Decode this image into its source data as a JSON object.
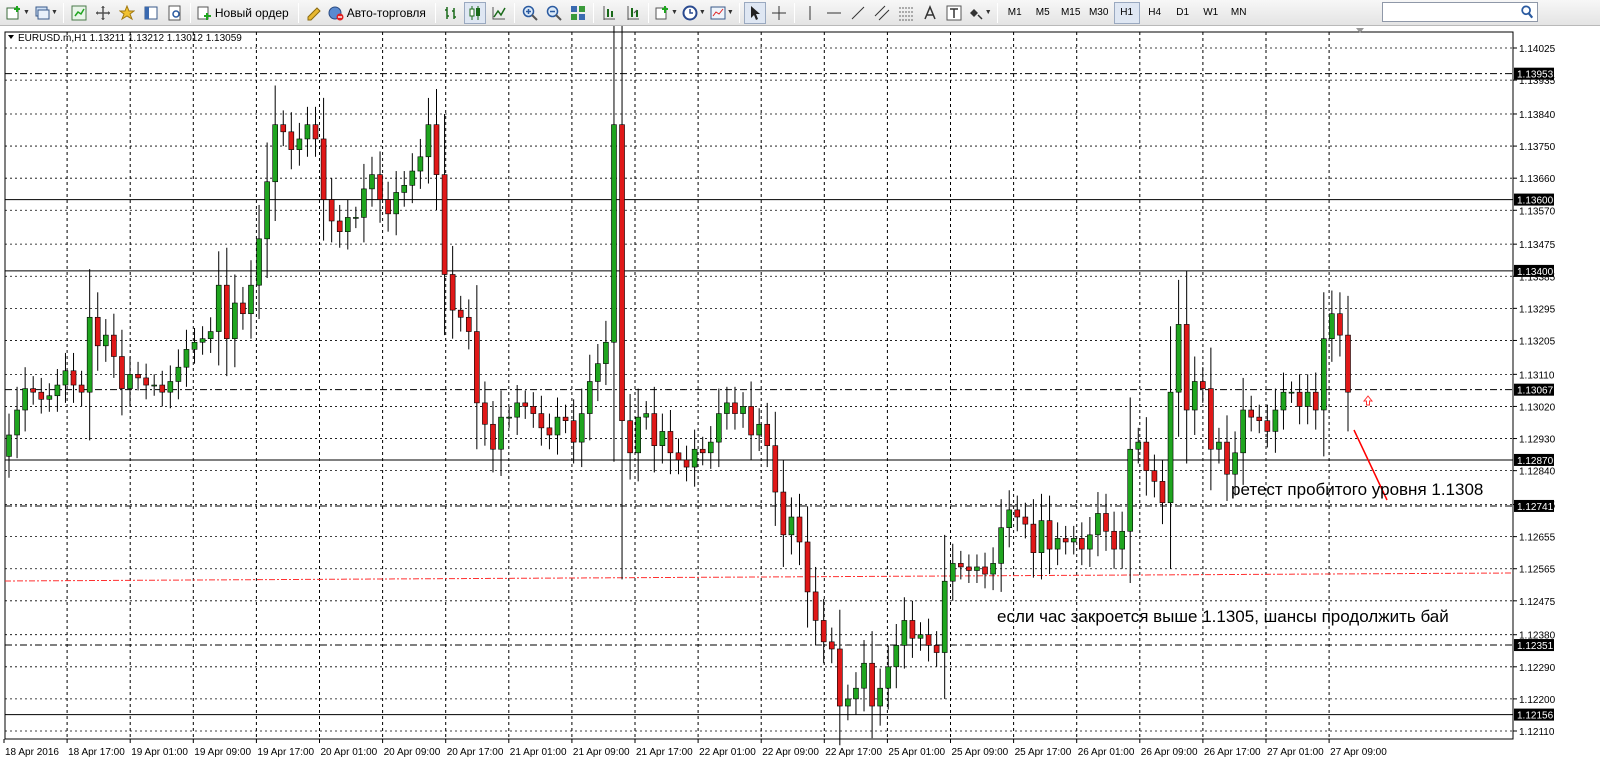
{
  "toolbar": {
    "new_order_label": "Новый ордер",
    "auto_trading_label": "Авто-торговля",
    "timeframes": [
      "M1",
      "M5",
      "M15",
      "M30",
      "H1",
      "H4",
      "D1",
      "W1",
      "MN"
    ],
    "active_timeframe": "H1",
    "search_value": ""
  },
  "chart": {
    "header": "EURUSD.m,H1  1.13211 1.13212 1.13012 1.13059",
    "bull_color": "#1fa51f",
    "bear_color": "#e01818",
    "price_axis_ticks": [
      "1.14025",
      "1.13935",
      "1.13840",
      "1.13750",
      "1.13660",
      "1.13570",
      "1.13475",
      "1.13385",
      "1.13295",
      "1.13205",
      "1.13110",
      "1.13020",
      "1.12930",
      "1.12840",
      "1.12745",
      "1.12655",
      "1.12565",
      "1.12475",
      "1.12380",
      "1.12290",
      "1.12200",
      "1.12110"
    ],
    "level_lines": [
      {
        "price": 1.13953,
        "label": "1.13953",
        "style": "dashdot"
      },
      {
        "price": 1.136,
        "label": "1.13600",
        "style": "solid"
      },
      {
        "price": 1.134,
        "label": "1.13400",
        "style": "solid"
      },
      {
        "price": 1.13067,
        "label": "1.13067",
        "style": "dashdot"
      },
      {
        "price": 1.1287,
        "label": "1.12870",
        "style": "solid"
      },
      {
        "price": 1.12741,
        "label": "1.12741",
        "style": "dashdot"
      },
      {
        "price": 1.12351,
        "label": "1.12351",
        "style": "dashdot"
      },
      {
        "price": 1.12156,
        "label": "1.12156",
        "style": "solid"
      }
    ],
    "time_axis_labels": [
      "18 Apr 2016",
      "18 Apr 17:00",
      "19 Apr 01:00",
      "19 Apr 09:00",
      "19 Apr 17:00",
      "20 Apr 01:00",
      "20 Apr 09:00",
      "20 Apr 17:00",
      "21 Apr 01:00",
      "21 Apr 09:00",
      "21 Apr 17:00",
      "22 Apr 01:00",
      "22 Apr 09:00",
      "22 Apr 17:00",
      "25 Apr 01:00",
      "25 Apr 09:00",
      "25 Apr 17:00",
      "26 Apr 01:00",
      "26 Apr 09:00",
      "26 Apr 17:00",
      "27 Apr 01:00",
      "27 Apr 09:00"
    ],
    "annotations": {
      "retest": "ретест пробитого уровня 1.1308",
      "continue_buy": "если час закроется выше 1.1305, шансы продолжить бай"
    },
    "candles_close": [
      1.1294,
      1.1301,
      1.1307,
      1.1306,
      1.1304,
      1.1305,
      1.1308,
      1.1312,
      1.1308,
      1.1306,
      1.1327,
      1.1319,
      1.1322,
      1.1316,
      1.1307,
      1.1311,
      1.131,
      1.1308,
      1.1308,
      1.1306,
      1.1309,
      1.1313,
      1.1318,
      1.132,
      1.1321,
      1.1323,
      1.1336,
      1.1321,
      1.1331,
      1.1328,
      1.1336,
      1.1349,
      1.1365,
      1.1381,
      1.1379,
      1.1374,
      1.1377,
      1.1381,
      1.1377,
      1.136,
      1.1354,
      1.1351,
      1.1355,
      1.1355,
      1.1363,
      1.1367,
      1.136,
      1.1356,
      1.1362,
      1.1364,
      1.1368,
      1.1372,
      1.1381,
      1.1367,
      1.1339,
      1.1329,
      1.1327,
      1.1323,
      1.1303,
      1.1297,
      1.129,
      1.1299,
      1.1299,
      1.1303,
      1.1302,
      1.13,
      1.1296,
      1.1294,
      1.1299,
      1.1298,
      1.1292,
      1.13,
      1.1309,
      1.1314,
      1.132,
      1.1381,
      1.1298,
      1.1289,
      1.1299,
      1.13,
      1.1291,
      1.1295,
      1.1289,
      1.1287,
      1.1285,
      1.129,
      1.1289,
      1.1292,
      1.13,
      1.1303,
      1.13,
      1.1302,
      1.1294,
      1.1297,
      1.1291,
      1.1278,
      1.1266,
      1.1271,
      1.1264,
      1.125,
      1.1242,
      1.1236,
      1.1234,
      1.1218,
      1.122,
      1.1223,
      1.123,
      1.1218,
      1.1223,
      1.1229,
      1.1235,
      1.1242,
      1.1237,
      1.1238,
      1.1235,
      1.1233,
      1.1253,
      1.1258,
      1.1257,
      1.1256,
      1.1257,
      1.1255,
      1.1258,
      1.1268,
      1.1273,
      1.1271,
      1.1269,
      1.1261,
      1.127,
      1.1262,
      1.1265,
      1.1264,
      1.1265,
      1.1262,
      1.1266,
      1.1272,
      1.1267,
      1.1262,
      1.1267,
      1.129,
      1.1292,
      1.1284,
      1.1281,
      1.1275,
      1.1306,
      1.1325,
      1.1301,
      1.1309,
      1.1307,
      1.129,
      1.1292,
      1.1283,
      1.1289,
      1.1301,
      1.1299,
      1.1298,
      1.1295,
      1.1301,
      1.1306,
      1.1306,
      1.1302,
      1.1306,
      1.1301,
      1.1321,
      1.1328,
      1.1322,
      1.1306
    ]
  }
}
